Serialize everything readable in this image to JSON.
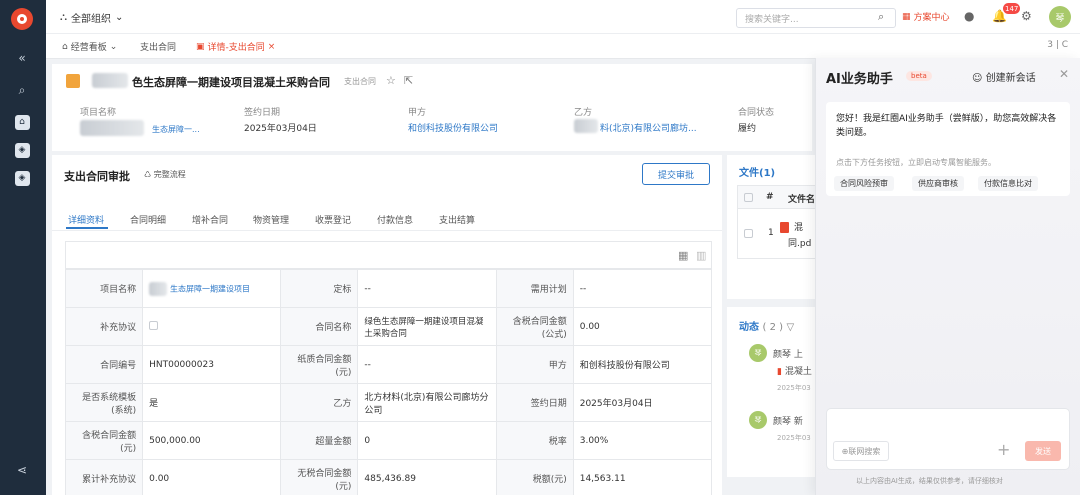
{
  "topbar": {
    "org_label": "全部组织",
    "search_placeholder": "搜索关键字...",
    "plan_center": "方案中心",
    "notification_count": "147",
    "avatar_initial": "琴"
  },
  "tabs": [
    {
      "label": "经营看板"
    },
    {
      "label": "支出合同"
    },
    {
      "label": "详情-支出合同"
    }
  ],
  "tab_tail": "3 | C",
  "contract": {
    "title": "色生态屏障一期建设项目混凝土采购合同",
    "title_tag": "支出合同",
    "fields": {
      "project_label": "项目名称",
      "project_value": "生态屏障一...",
      "sign_date_label": "签约日期",
      "sign_date_value": "2025年03月04日",
      "party_a_label": "甲方",
      "party_a_value": "和创科技股份有限公司",
      "party_b_label": "乙方",
      "party_b_value": "料(北京)有限公司廊坊...",
      "status_label": "合同状态",
      "status_value": "履约"
    }
  },
  "approval": {
    "title": "支出合同审批",
    "flow_link": "完整流程",
    "submit_button": "提交审批",
    "subtabs": [
      "详细资料",
      "合同明细",
      "增补合同",
      "物资管理",
      "收票登记",
      "付款信息",
      "支出结算"
    ]
  },
  "form": {
    "rows": [
      {
        "k1": "项目名称",
        "v1": "生态屏障一期建设项目",
        "k2": "定标",
        "v2": "--",
        "k3": "需用计划",
        "v3": "--"
      },
      {
        "k1": "补充协议",
        "v1": "",
        "k2": "合同名称",
        "v2": "绿色生态屏障一期建设项目混凝土采购合同",
        "k3": "含税合同金额(公式)",
        "v3": "0.00"
      },
      {
        "k1": "合同编号",
        "v1": "HNT00000023",
        "k2": "纸质合同金额(元)",
        "v2": "--",
        "k3": "甲方",
        "v3": "和创科技股份有限公司"
      },
      {
        "k1": "是否系统模板(系统)",
        "v1": "是",
        "k2": "乙方",
        "v2": "北方材料(北京)有限公司廊坊分公司",
        "k3": "签约日期",
        "v3": "2025年03月04日"
      },
      {
        "k1": "含税合同金额(元)",
        "v1": "500,000.00",
        "k2": "超量金额",
        "v2": "0",
        "k3": "税率",
        "v3": "3.00%"
      },
      {
        "k1": "累计补充协议",
        "v1": "0.00",
        "k2": "无税合同金额(元)",
        "v2": "485,436.89",
        "k3": "税额(元)",
        "v3": "14,563.11"
      }
    ]
  },
  "files": {
    "title": "文件(1)",
    "col_hash": "#",
    "col_name": "文件名",
    "row_index": "1",
    "row_name_line1": "混",
    "row_name_line2": "同.pd"
  },
  "activity": {
    "title": "动态",
    "count": "( 2 )",
    "items": [
      {
        "avatar": "琴",
        "name": "颜琴",
        "action": "上",
        "file": "混凝土",
        "time": "2025年03"
      },
      {
        "avatar": "琴",
        "name": "颜琴",
        "action": "新",
        "time": "2025年03"
      }
    ]
  },
  "ai": {
    "title": "AI业务助手",
    "beta": "beta",
    "new_chat": "创建新会话",
    "greeting": "您好！我是红圈AI业务助手（尝鲜版），助您高效解决各类问题。",
    "hint": "点击下方任务按钮，立即启动专属智能服务。",
    "chips": [
      "合同风险预审",
      "供应商审核",
      "付款信息比对"
    ],
    "web_search": "联网搜索",
    "send": "发送",
    "footer": "以上内容由AI生成，结果仅供参考，请仔细核对"
  }
}
